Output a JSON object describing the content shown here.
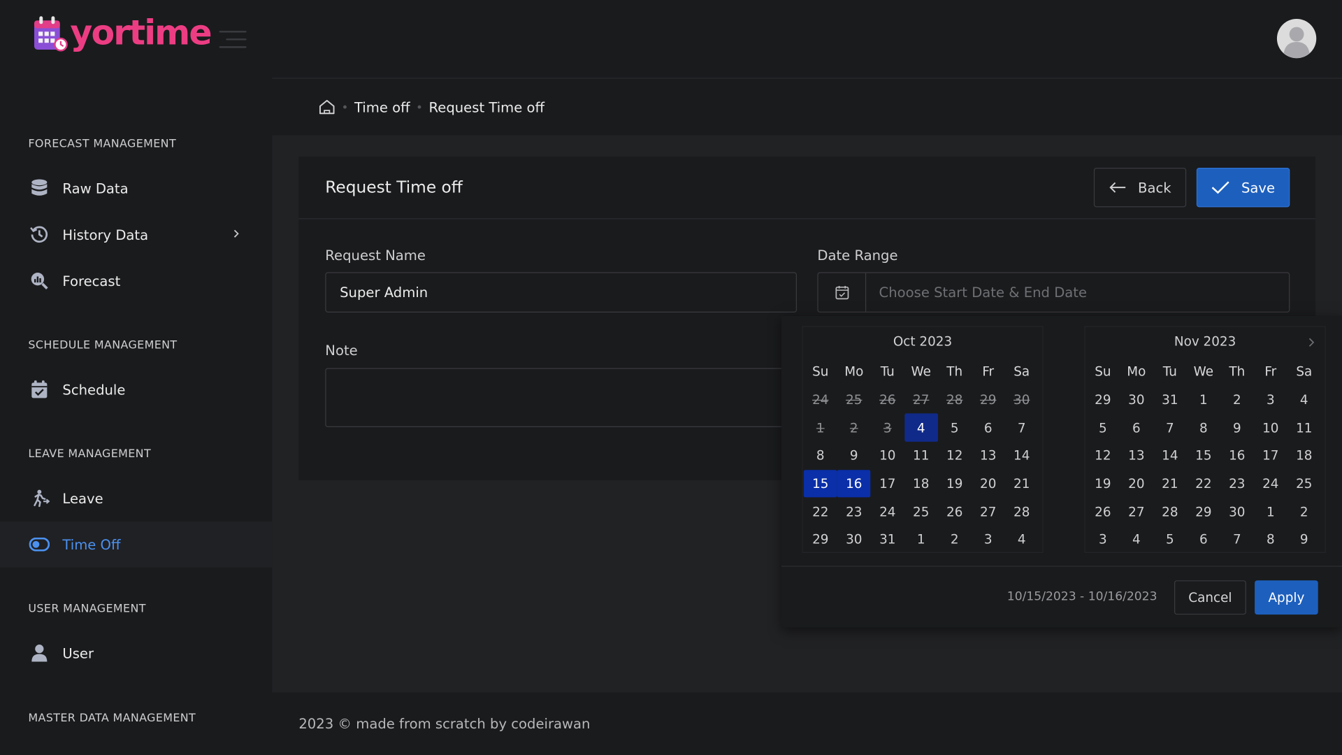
{
  "app": {
    "logo_text": "yortime"
  },
  "sidebar": {
    "sections": [
      {
        "label": "FORECAST MANAGEMENT"
      },
      {
        "label": "SCHEDULE MANAGEMENT"
      },
      {
        "label": "LEAVE MANAGEMENT"
      },
      {
        "label": "USER MANAGEMENT"
      },
      {
        "label": "MASTER DATA MANAGEMENT"
      }
    ],
    "items": [
      {
        "label": "Raw Data",
        "icon": "database-icon"
      },
      {
        "label": "History Data",
        "icon": "history-icon"
      },
      {
        "label": "Forecast",
        "icon": "forecast-icon"
      },
      {
        "label": "Schedule",
        "icon": "calendar-icon"
      },
      {
        "label": "Leave",
        "icon": "running-person-icon"
      },
      {
        "label": "Time Off",
        "icon": "toggle-icon",
        "active": true
      },
      {
        "label": "User",
        "icon": "user-icon"
      }
    ]
  },
  "breadcrumb": {
    "items": [
      "Time off",
      "Request Time off"
    ]
  },
  "card": {
    "title": "Request Time off",
    "back_label": "Back",
    "save_label": "Save"
  },
  "form": {
    "request_name_label": "Request Name",
    "request_name_value": "Super Admin",
    "date_range_label": "Date Range",
    "date_range_placeholder": "Choose Start Date & End Date",
    "note_label": "Note",
    "note_value": ""
  },
  "datepicker": {
    "calendars": [
      {
        "title": "Oct 2023",
        "weekdays": [
          "Su",
          "Mo",
          "Tu",
          "We",
          "Th",
          "Fr",
          "Sa"
        ],
        "days": [
          "24",
          "25",
          "26",
          "27",
          "28",
          "29",
          "30",
          "1",
          "2",
          "3",
          "4",
          "5",
          "6",
          "7",
          "8",
          "9",
          "10",
          "11",
          "12",
          "13",
          "14",
          "15",
          "16",
          "17",
          "18",
          "19",
          "20",
          "21",
          "22",
          "23",
          "24",
          "25",
          "26",
          "27",
          "28",
          "29",
          "30",
          "31",
          "1",
          "2",
          "3",
          "4"
        ]
      },
      {
        "title": "Nov 2023",
        "weekdays": [
          "Su",
          "Mo",
          "Tu",
          "We",
          "Th",
          "Fr",
          "Sa"
        ],
        "days": [
          "29",
          "30",
          "31",
          "1",
          "2",
          "3",
          "4",
          "5",
          "6",
          "7",
          "8",
          "9",
          "10",
          "11",
          "12",
          "13",
          "14",
          "15",
          "16",
          "17",
          "18",
          "19",
          "20",
          "21",
          "22",
          "23",
          "24",
          "25",
          "26",
          "27",
          "28",
          "29",
          "30",
          "1",
          "2",
          "3",
          "4",
          "5",
          "6",
          "7",
          "8",
          "9"
        ]
      }
    ],
    "range_text": "10/15/2023 - 10/16/2023",
    "cancel_label": "Cancel",
    "apply_label": "Apply",
    "selected_color": "#0a2fa8",
    "accent_color": "#1d5fbd"
  },
  "footer": {
    "text": "2023 © made from scratch by codeirawan"
  }
}
